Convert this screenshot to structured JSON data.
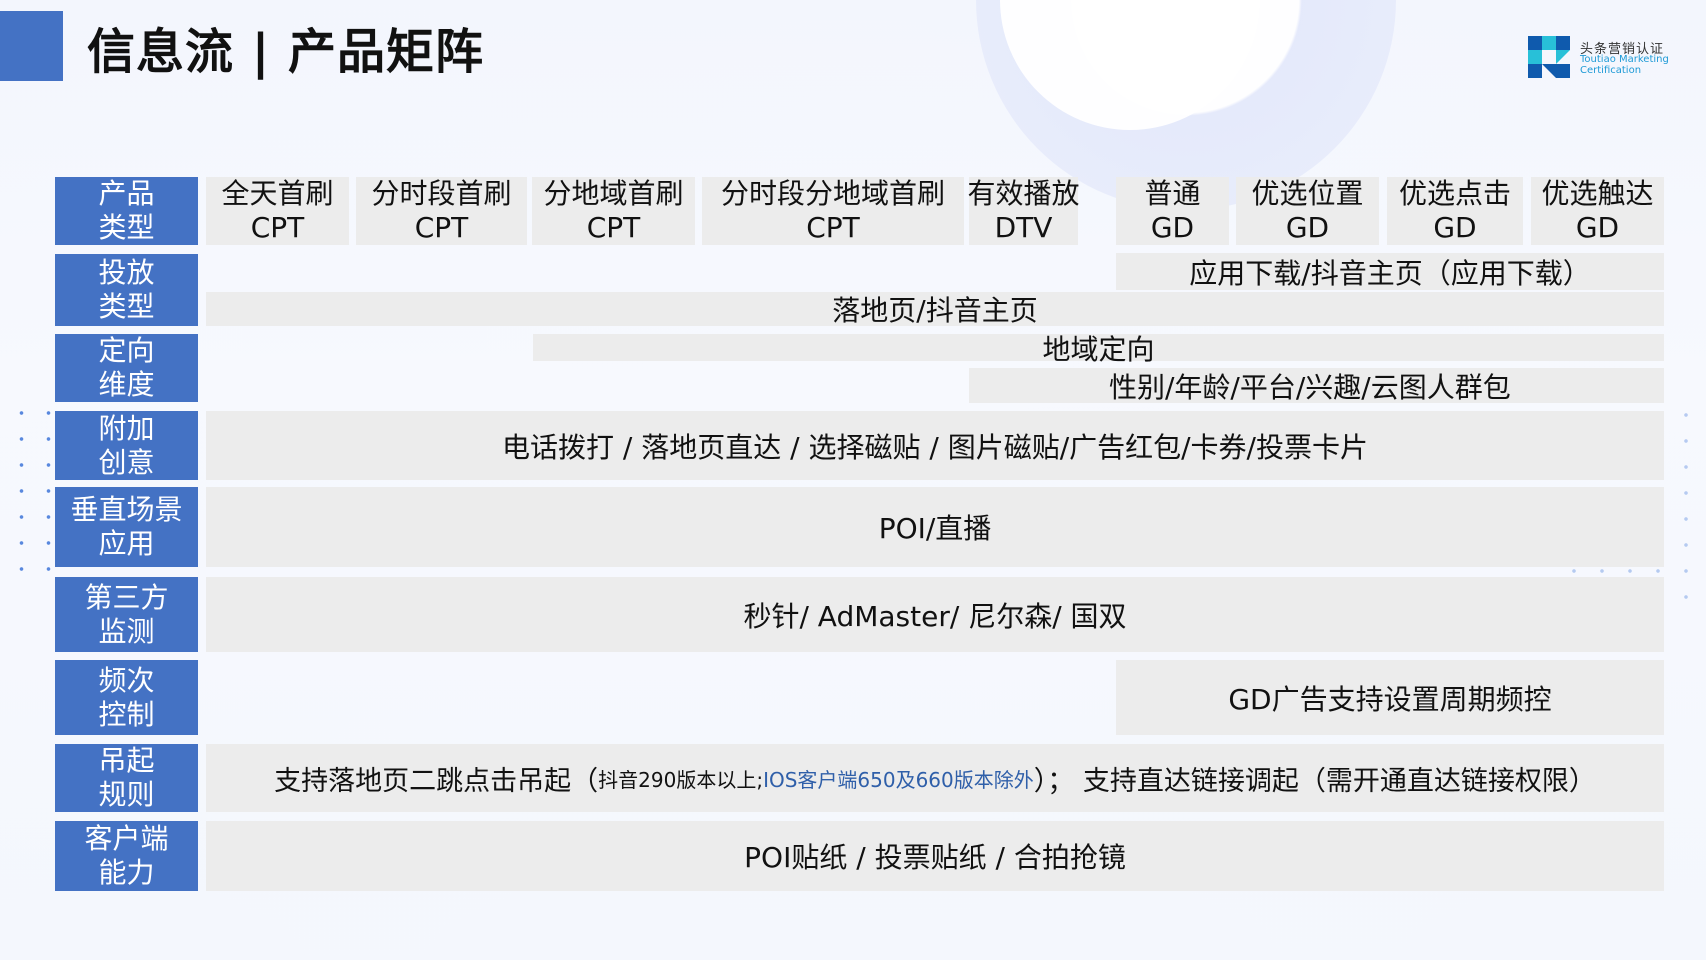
{
  "title": "信息流 | 产品矩阵",
  "logo": {
    "cn": "头条营销认证",
    "en_line1": "Toutiao Marketing",
    "en_line2": "Certification",
    "colors": {
      "dark": "#0f5aad",
      "light": "#28c0d8"
    }
  },
  "colors": {
    "header_bg": "#4472c4",
    "cell_bg": "#ececec",
    "note_blue": "#2f5fa9"
  },
  "row_headers": [
    {
      "line1": "产品",
      "line2": "类型"
    },
    {
      "line1": "投放",
      "line2": "类型"
    },
    {
      "line1": "定向",
      "line2": "维度"
    },
    {
      "line1": "附加",
      "line2": "创意"
    },
    {
      "line1": "垂直场景",
      "line2": "应用"
    },
    {
      "line1": "第三方",
      "line2": "监测"
    },
    {
      "line1": "频次",
      "line2": "控制"
    },
    {
      "line1": "吊起",
      "line2": "规则"
    },
    {
      "line1": "客户端",
      "line2": "能力"
    }
  ],
  "products": [
    {
      "name": "全天首刷",
      "type": "CPT"
    },
    {
      "name": "分时段首刷",
      "type": "CPT"
    },
    {
      "name": "分地域首刷",
      "type": "CPT"
    },
    {
      "name": "分时段分地域首刷",
      "type": "CPT"
    },
    {
      "name": "有效播放",
      "type": "DTV"
    },
    {
      "name": "普通",
      "type": "GD"
    },
    {
      "name": "优选位置",
      "type": "GD"
    },
    {
      "name": "优选点击",
      "type": "GD"
    },
    {
      "name": "优选触达",
      "type": "GD"
    }
  ],
  "delivery": {
    "app_download": "应用下载/抖音主页（应用下载）",
    "landing": "落地页/抖音主页"
  },
  "targeting": {
    "region": "地域定向",
    "audience": "性别/年龄/平台/兴趣/云图人群包"
  },
  "extra_creative": "电话拨打 / 落地页直达 / 选择磁贴 / 图片磁贴/广告红包/卡券/投票卡片",
  "vertical": "POI/直播",
  "monitoring": "秒针/ AdMaster/ 尼尔森/ 国双",
  "frequency": "GD广告支持设置周期频控",
  "invoke": {
    "part1": "支持落地页二跳点击吊起（",
    "note1": "抖音290版本以上;  ",
    "note2": "IOS客户端650及660版本除外",
    "part2": "）；  支持直达链接调起（需开通直达链接权限）"
  },
  "client": "POI贴纸 / 投票贴纸 / 合拍抢镜"
}
